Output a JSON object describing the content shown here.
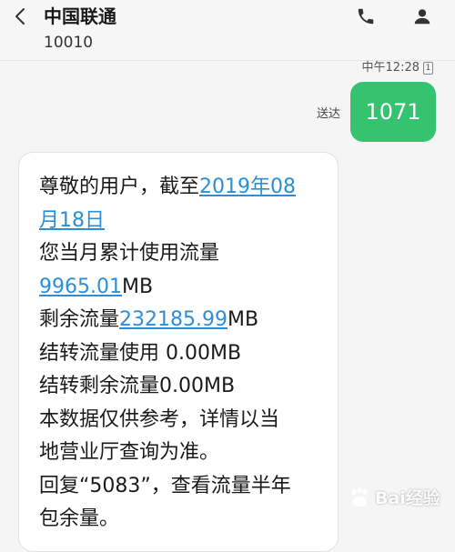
{
  "header": {
    "title": "中国联通",
    "number": "10010"
  },
  "outgoing": {
    "time": "中午12:28",
    "sim": "1",
    "status": "送达",
    "text": "1071"
  },
  "incoming": {
    "lines": [
      [
        "尊敬的用户，截至",
        "2019年08"
      ],
      [
        "",
        "月18日"
      ],
      [
        " 您当月累计使用流量",
        ""
      ],
      [
        "",
        "9965.01",
        "MB"
      ],
      [
        " 剩余流量",
        "232185.99",
        "MB"
      ],
      [
        " 结转流量使用 0.00MB",
        ""
      ],
      [
        " 结转剩余流量0.00MB",
        ""
      ],
      [
        " 本数据仅供参考，详情以当",
        ""
      ],
      [
        "地营业厅查询为准。",
        ""
      ],
      [
        " 回复“5083”，查看流量半年",
        ""
      ],
      [
        "包余量。",
        ""
      ]
    ]
  },
  "watermark": {
    "text": "Bai经验"
  },
  "colors": {
    "bubble_out": "#35c36f",
    "link": "#2a8fd6"
  }
}
